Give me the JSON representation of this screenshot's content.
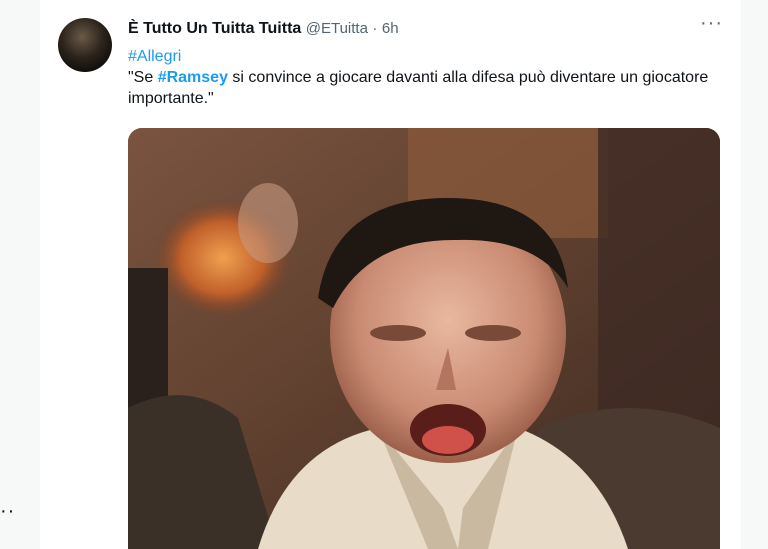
{
  "tweet": {
    "display_name": "È Tutto Un Tuitta Tuitta",
    "handle": "@ETuitta",
    "separator": "·",
    "time": "6h",
    "more_label": "···",
    "hashtag_line": "#Allegri",
    "text_prefix": "\"Se ",
    "text_hashtag": "#Ramsey",
    "text_suffix": " si convince a giocare davanti alla difesa può diventare un giocatore importante.\""
  },
  "left_edge": {
    "dots": "··"
  },
  "colors": {
    "link": "#1d9bf0",
    "text": "#0f1419",
    "muted": "#536471"
  },
  "media": {
    "icon": "gif-image"
  }
}
